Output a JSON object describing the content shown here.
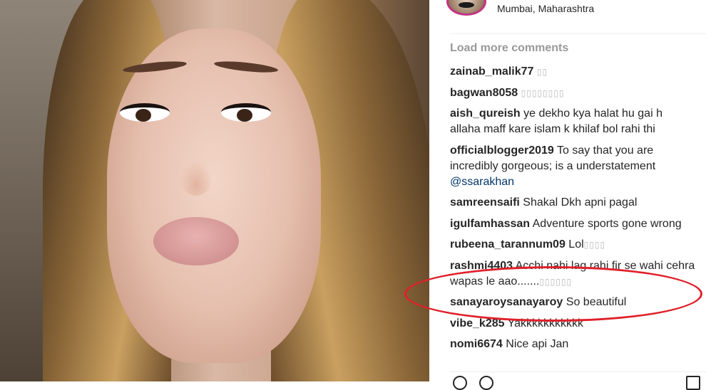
{
  "post": {
    "location": "Mumbai, Maharashtra"
  },
  "comments_section": {
    "load_more": "Load more comments",
    "items": [
      {
        "user": "zainab_malik77",
        "text": "",
        "emoji": "▯▯"
      },
      {
        "user": "bagwan8058",
        "text": "",
        "emoji": "▯▯▯▯▯▯▯▯"
      },
      {
        "user": "aish_qureish",
        "text": "ye dekho kya halat hu gai h allaha maff kare islam k khilaf bol rahi thi",
        "emoji": ""
      },
      {
        "user": "officialblogger2019",
        "text": "To say that you are incredibly gorgeous; is a understatement",
        "mention": "@ssarakhan",
        "emoji": ""
      },
      {
        "user": "samreensaifi",
        "text": "Shakal Dkh apni pagal",
        "emoji": ""
      },
      {
        "user": "igulfamhassan",
        "text": "Adventure sports gone wrong",
        "emoji": ""
      },
      {
        "user": "rubeena_tarannum09",
        "text": "Lol",
        "emoji": "▯▯▯▯"
      },
      {
        "user": "rashmi4403",
        "text": "Acchi nahi lag rahi fir se wahi cehra wapas le aao.......",
        "emoji": "▯▯▯▯▯▯"
      },
      {
        "user": "sanayaroysanayaroy",
        "text": "So beautiful",
        "emoji": ""
      },
      {
        "user": "vibe_k285",
        "text": "Yakkkkkkkkkkk",
        "emoji": ""
      },
      {
        "user": "nomi6674",
        "text": "Nice api Jan",
        "emoji": ""
      }
    ]
  },
  "annotation": {
    "color": "#e0202a",
    "target": "rashmi4403 comment"
  },
  "colors": {
    "username": "#262626",
    "load_more": "#999999",
    "mention": "#003569",
    "story_ring": "#c13584"
  }
}
